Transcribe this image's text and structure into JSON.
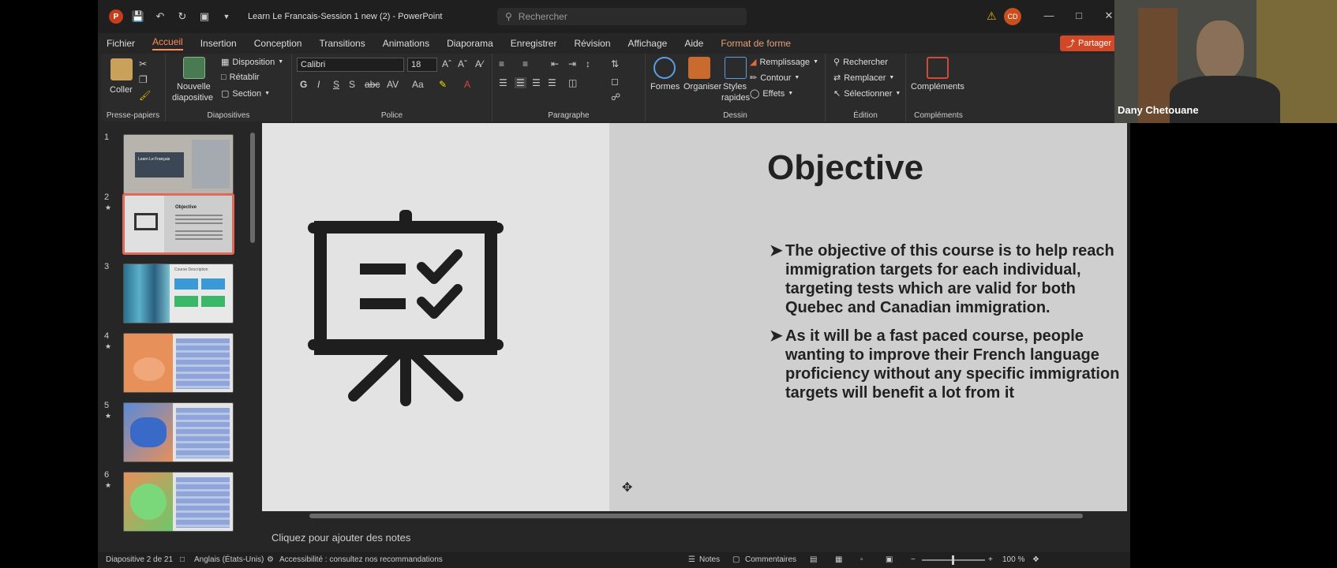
{
  "titlebar": {
    "logo_letter": "P",
    "doc_title": "Learn Le Francais-Session 1 new (2) - PowerPoint",
    "search_placeholder": "Rechercher",
    "avatar_initials": "CD"
  },
  "menu": {
    "items": [
      "Fichier",
      "Accueil",
      "Insertion",
      "Conception",
      "Transitions",
      "Animations",
      "Diaporama",
      "Enregistrer",
      "Révision",
      "Affichage",
      "Aide",
      "Format de forme"
    ],
    "share_label": "Partager"
  },
  "ribbon": {
    "groups": {
      "clipboard": "Presse-papiers",
      "slides": "Diapositives",
      "font": "Police",
      "paragraph": "Paragraphe",
      "drawing": "Dessin",
      "editing": "Édition",
      "addins": "Compléments"
    },
    "paste_label": "Coller",
    "new_slide_label": "Nouvelle",
    "new_slide_label2": "diapositive",
    "layout_label": "Disposition",
    "reset_label": "Rétablir",
    "section_label": "Section",
    "font_name": "Calibri",
    "font_size": "18",
    "shapes_label": "Formes",
    "arrange_label": "Organiser",
    "styles_label": "Styles",
    "styles_label2": "rapides",
    "fill_label": "Remplissage",
    "outline_label": "Contour",
    "effects_label": "Effets",
    "find_label": "Rechercher",
    "replace_label": "Remplacer",
    "select_label": "Sélectionner",
    "addins_label": "Compléments"
  },
  "thumbnails": [
    {
      "num": "1",
      "star": false,
      "title": "Learn Le Français"
    },
    {
      "num": "2",
      "star": true,
      "title": "Objective",
      "selected": true
    },
    {
      "num": "3",
      "star": false,
      "title": "Course Description"
    },
    {
      "num": "4",
      "star": true,
      "title": ""
    },
    {
      "num": "5",
      "star": true,
      "title": ""
    },
    {
      "num": "6",
      "star": true,
      "title": ""
    }
  ],
  "slide": {
    "title": "Objective",
    "bullets": [
      "The objective of this course is to help reach  immigration targets for each individual, targeting tests which are valid for both Quebec and Canadian immigration.",
      "As it will be a fast paced course, people wanting to improve their French language proficiency without any specific immigration targets will benefit a lot from it"
    ]
  },
  "notes_placeholder": "Cliquez pour ajouter des notes",
  "statusbar": {
    "slide_count": "Diapositive 2 de 21",
    "language": "Anglais (États-Unis)",
    "accessibility": "Accessibilité : consultez nos recommandations",
    "notes_label": "Notes",
    "comments_label": "Commentaires",
    "zoom": "100 %"
  },
  "webcam": {
    "name": "Dany Chetouane"
  }
}
